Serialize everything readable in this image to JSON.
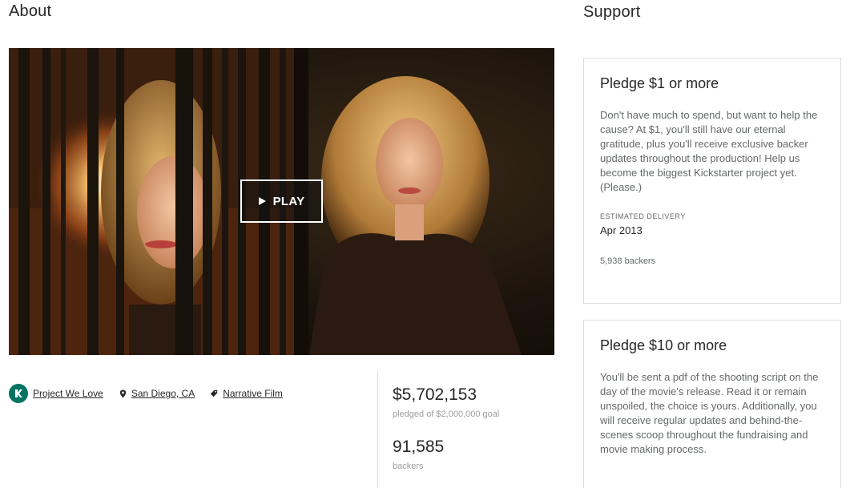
{
  "about": {
    "heading": "About"
  },
  "support": {
    "heading": "Support"
  },
  "video": {
    "play_label": "PLAY"
  },
  "tags": {
    "project_we_love": "Project We Love",
    "location": "San Diego, CA",
    "category": "Narrative Film"
  },
  "stats": {
    "pledged_amount": "$5,702,153",
    "pledged_label": "pledged of $2,000,000 goal",
    "backers_count": "91,585",
    "backers_label": "backers"
  },
  "rewards": [
    {
      "title": "Pledge $1 or more",
      "description": "Don't have much to spend, but want to help the cause? At $1, you'll still have our eternal gratitude, plus you'll receive exclusive backer updates throughout the production! Help us become the biggest Kickstarter project yet. (Please.)",
      "delivery_label": "ESTIMATED DELIVERY",
      "delivery_value": "Apr 2013",
      "backers": "5,938 backers"
    },
    {
      "title": "Pledge $10 or more",
      "description": "You'll be sent a pdf of the shooting script on the day of the movie's release. Read it or remain unspoiled, the choice is yours. Additionally, you will receive regular updates and behind-the-scenes scoop throughout the fundraising and movie making process."
    }
  ],
  "colors": {
    "brand_green": "#037362",
    "text_primary": "#282828",
    "text_muted": "#9e9e9e",
    "border": "#dcdedd"
  },
  "icons": [
    "kickstarter-k-icon",
    "location-pin-icon",
    "tag-icon",
    "play-icon"
  ]
}
